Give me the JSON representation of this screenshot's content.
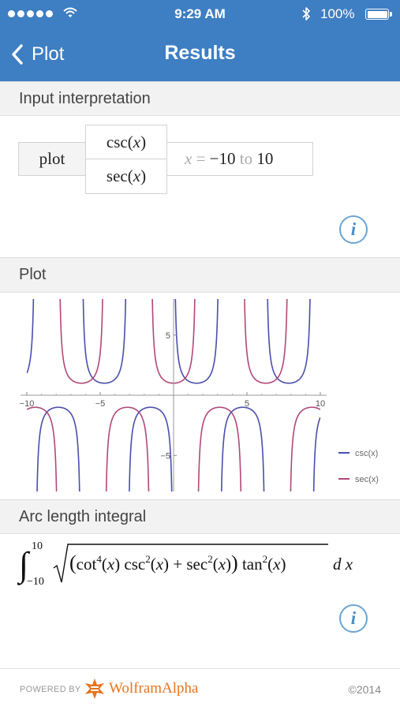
{
  "status_bar": {
    "signal_dots": 5,
    "time": "9:29 AM",
    "battery": "100%"
  },
  "nav": {
    "back_label": "Plot",
    "title": "Results"
  },
  "input_pod": {
    "header": "Input interpretation",
    "command": "plot",
    "functions": [
      "csc(x)",
      "sec(x)"
    ],
    "range": {
      "var": "x",
      "eq": "=",
      "from": "−10",
      "to_word": "to",
      "to": "10"
    }
  },
  "plot_pod": {
    "header": "Plot"
  },
  "arc_pod": {
    "header": "Arc length integral",
    "lower": "−10",
    "upper": "10",
    "integrand_tail": "d x"
  },
  "chart_data": {
    "type": "line",
    "title": "",
    "xlabel": "",
    "ylabel": "",
    "xlim": [
      -10,
      10
    ],
    "ylim": [
      -8,
      8
    ],
    "x_ticks": [
      -10,
      -5,
      5,
      10
    ],
    "y_ticks": [
      5,
      -5
    ],
    "x_tick_labels": [
      "−10",
      "−5",
      "5",
      "10"
    ],
    "y_tick_labels": [
      "5",
      "−5"
    ],
    "grid": false,
    "legend": "right",
    "series": [
      {
        "name": "csc(x)",
        "function": "1/sin(x)",
        "color": "#4a4eaa"
      },
      {
        "name": "sec(x)",
        "function": "1/cos(x)",
        "color": "#b04878"
      }
    ]
  },
  "footer": {
    "powered_by": "POWERED BY",
    "brand": "WolframAlpha",
    "copyright": "©2014"
  },
  "colors": {
    "header_bg": "#3e7ec2",
    "accent_orange": "#e8731b",
    "info_blue": "#4a8cc7"
  }
}
